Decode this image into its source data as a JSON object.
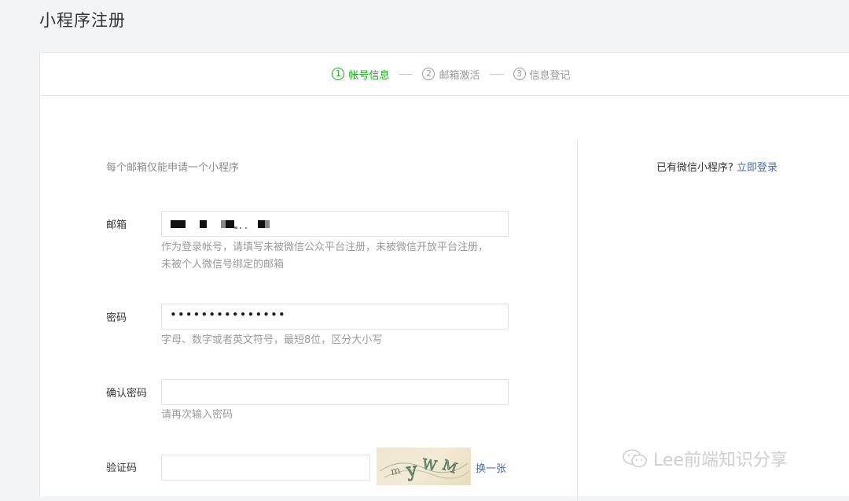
{
  "page_title": "小程序注册",
  "steps": [
    {
      "num": "1",
      "label": "帐号信息",
      "active": true
    },
    {
      "num": "2",
      "label": "邮箱激活",
      "active": false
    },
    {
      "num": "3",
      "label": "信息登记",
      "active": false
    }
  ],
  "form": {
    "notice": "每个邮箱仅能申请一个小程序",
    "email": {
      "label": "邮箱",
      "value_masked": "■■ ■ ■■.. ■",
      "hint_line1": "作为登录帐号，请填写未被微信公众平台注册，未被微信开放平台注册，",
      "hint_line2": "未被个人微信号绑定的邮箱"
    },
    "password": {
      "label": "密码",
      "value": "•••••••••••••••",
      "hint": "字母、数字或者英文符号，最短8位，区分大小写"
    },
    "confirm_password": {
      "label": "确认密码",
      "value": "",
      "hint": "请再次输入密码"
    },
    "captcha": {
      "label": "验证码",
      "value": "",
      "image_text": "myWM",
      "refresh_label": "换一张"
    }
  },
  "sidebar": {
    "login_prompt": "已有微信小程序?",
    "login_link": "立即登录"
  },
  "watermark": "Lee前端知识分享",
  "colors": {
    "accent_green": "#1aad19",
    "link_blue": "#4a6fa5"
  }
}
